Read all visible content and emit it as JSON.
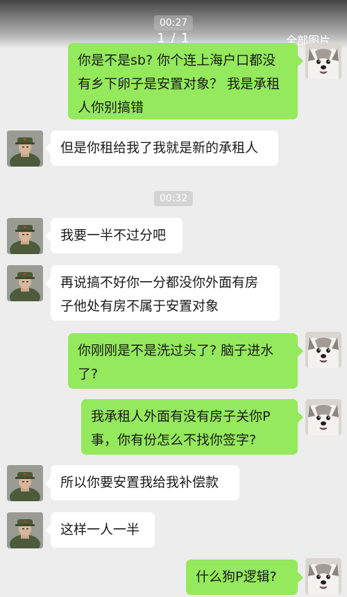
{
  "header": {
    "timestamp_top": "00:27",
    "counter": "1 / 1",
    "all_images": "全部图片"
  },
  "messages": [
    {
      "side": "right",
      "text": "你是不是sb? 你个连上海户口都没有乡下卵子是安置对象？ 我是承租人你别搞错"
    },
    {
      "side": "left",
      "text": "但是你租给我了我就是新的承租人"
    },
    {
      "type": "time",
      "text": "00:32"
    },
    {
      "side": "left",
      "text": "我要一半不过分吧"
    },
    {
      "side": "left",
      "text": "再说搞不好你一分都没你外面有房子他处有房不属于安置对象"
    },
    {
      "side": "right",
      "text": "你刚刚是不是洗过头了? 脑子进水了?"
    },
    {
      "side": "right",
      "text": "我承租人外面有没有房子关你P事，你有份怎么不找你签字?"
    },
    {
      "side": "left",
      "text": "所以你要安置我给我补偿款"
    },
    {
      "side": "left",
      "text": "这样一人一半"
    },
    {
      "side": "right",
      "text": "什么狗P逻辑?"
    }
  ],
  "colors": {
    "background": "#ededed",
    "sent_bubble": "#94e95c",
    "received_bubble": "#ffffff",
    "timestamp_bg": "#d4d4d4"
  },
  "avatars": {
    "left": "soldier-avatar",
    "right": "dog-avatar"
  }
}
